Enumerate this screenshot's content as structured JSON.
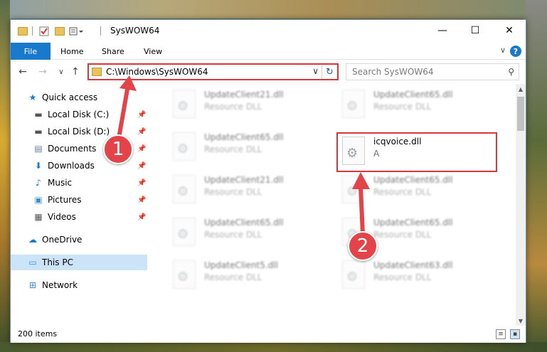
{
  "window": {
    "title": "SysWOW64",
    "minimize_glyph": "—",
    "maximize_glyph": "☐",
    "close_glyph": "✕"
  },
  "ribbon": {
    "tabs": [
      "File",
      "Home",
      "Share",
      "View"
    ],
    "help_glyph": "?",
    "expand_glyph": "∨"
  },
  "navigation": {
    "back_glyph": "←",
    "forward_glyph": "→",
    "recent_glyph": "∨",
    "up_glyph": "↑"
  },
  "address_bar": {
    "path": "C:\\Windows\\SysWOW64",
    "dropdown_glyph": "∨",
    "refresh_glyph": "↻"
  },
  "search": {
    "placeholder": "Search SysWOW64",
    "icon_glyph": "⚲"
  },
  "sidebar": {
    "pin_glyph": "📌",
    "items": [
      {
        "label": "Quick access",
        "icon": "star-icon",
        "glyph": "★",
        "color": "#1979ca",
        "pinned": false
      },
      {
        "label": "Local Disk (C:)",
        "icon": "drive-icon",
        "glyph": "▬",
        "color": "#555555",
        "pinned": true
      },
      {
        "label": "Local Disk (D:)",
        "icon": "drive-icon",
        "glyph": "▬",
        "color": "#555555",
        "pinned": true
      },
      {
        "label": "Documents",
        "icon": "documents-icon",
        "glyph": "▤",
        "color": "#6a7d99",
        "pinned": true
      },
      {
        "label": "Downloads",
        "icon": "download-icon",
        "glyph": "⬇",
        "color": "#1979ca",
        "pinned": true
      },
      {
        "label": "Music",
        "icon": "music-icon",
        "glyph": "♪",
        "color": "#1979ca",
        "pinned": true
      },
      {
        "label": "Pictures",
        "icon": "pictures-icon",
        "glyph": "▣",
        "color": "#3b8fd4",
        "pinned": true
      },
      {
        "label": "Videos",
        "icon": "videos-icon",
        "glyph": "▦",
        "color": "#555555",
        "pinned": true
      },
      {
        "label": "OneDrive",
        "icon": "cloud-icon",
        "glyph": "☁",
        "color": "#1979ca",
        "pinned": false
      },
      {
        "label": "This PC",
        "icon": "computer-icon",
        "glyph": "▭",
        "color": "#3b8fd4",
        "pinned": false,
        "selected": true
      },
      {
        "label": "Network",
        "icon": "network-icon",
        "glyph": "⊞",
        "color": "#3b8fd4",
        "pinned": false
      }
    ]
  },
  "files": [
    {
      "name": "UpdateClient21.dll",
      "desc": "Resource DLL",
      "blurred": true
    },
    {
      "name": "UpdateClient65.dll",
      "desc": "Resource DLL",
      "blurred": true
    },
    {
      "name": "UpdateClient65.dll",
      "desc": "Resource DLL",
      "blurred": true
    },
    {
      "name": "icqvoice.dll",
      "desc": "A",
      "blurred": false,
      "highlighted": true
    },
    {
      "name": "UpdateClient21.dll",
      "desc": "Resource DLL",
      "blurred": true
    },
    {
      "name": "UpdateClient65.dll",
      "desc": "Resource DLL",
      "blurred": true
    },
    {
      "name": "UpdateClient65.dll",
      "desc": "Resource DLL",
      "blurred": true
    },
    {
      "name": "UpdateClient65.dll",
      "desc": "Resource DLL",
      "blurred": true
    },
    {
      "name": "UpdateClient5.dll",
      "desc": "Resource DLL",
      "blurred": true
    },
    {
      "name": "UpdateClient63.dll",
      "desc": "Resource DLL",
      "blurred": true
    }
  ],
  "status": {
    "item_count": "200 items"
  },
  "annotations": {
    "step1": "1",
    "step2": "2",
    "color": "#e2444a"
  }
}
